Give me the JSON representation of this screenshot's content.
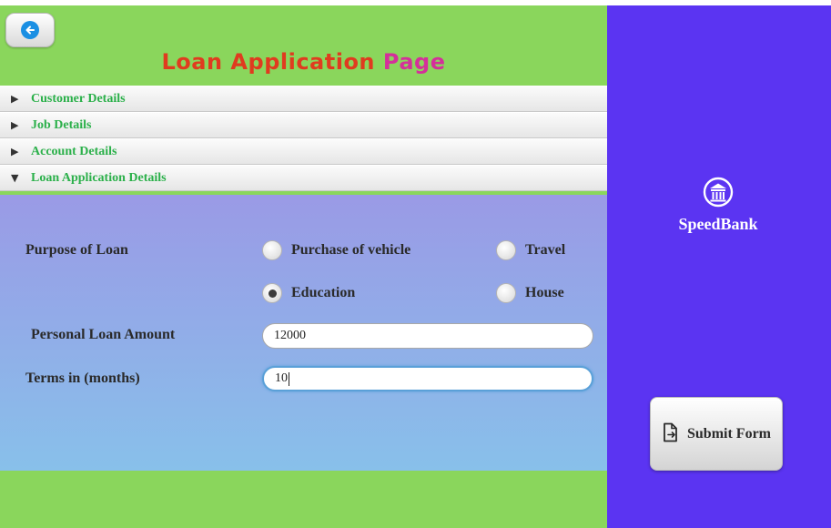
{
  "header": {
    "title_part1": "Loan Application",
    "title_part2": "Page"
  },
  "accordion": {
    "sections": [
      {
        "label": "Customer Details",
        "expanded": false
      },
      {
        "label": "Job Details",
        "expanded": false
      },
      {
        "label": "Account Details",
        "expanded": false
      },
      {
        "label": "Loan Application Details",
        "expanded": true
      }
    ]
  },
  "loan_form": {
    "purpose_label": "Purpose of Loan",
    "purpose_options": [
      {
        "label": "Purchase of vehicle",
        "selected": false
      },
      {
        "label": "Travel",
        "selected": false
      },
      {
        "label": "Education",
        "selected": true
      },
      {
        "label": "House",
        "selected": false
      }
    ],
    "amount_label": "Personal Loan Amount",
    "amount_value": "12000",
    "terms_label": "Terms in (months)",
    "terms_value": "10"
  },
  "brand": {
    "name": "SpeedBank"
  },
  "submit": {
    "label": "Submit Form"
  },
  "colors": {
    "green": "#8ad65c",
    "purple": "#5b34f2",
    "title_red": "#e03b1f",
    "title_pink": "#d4309a",
    "section_text": "#2bb04a"
  },
  "icons": {
    "back": "back-arrow-icon",
    "logo": "bank-building-icon",
    "submit": "document-export-icon"
  }
}
